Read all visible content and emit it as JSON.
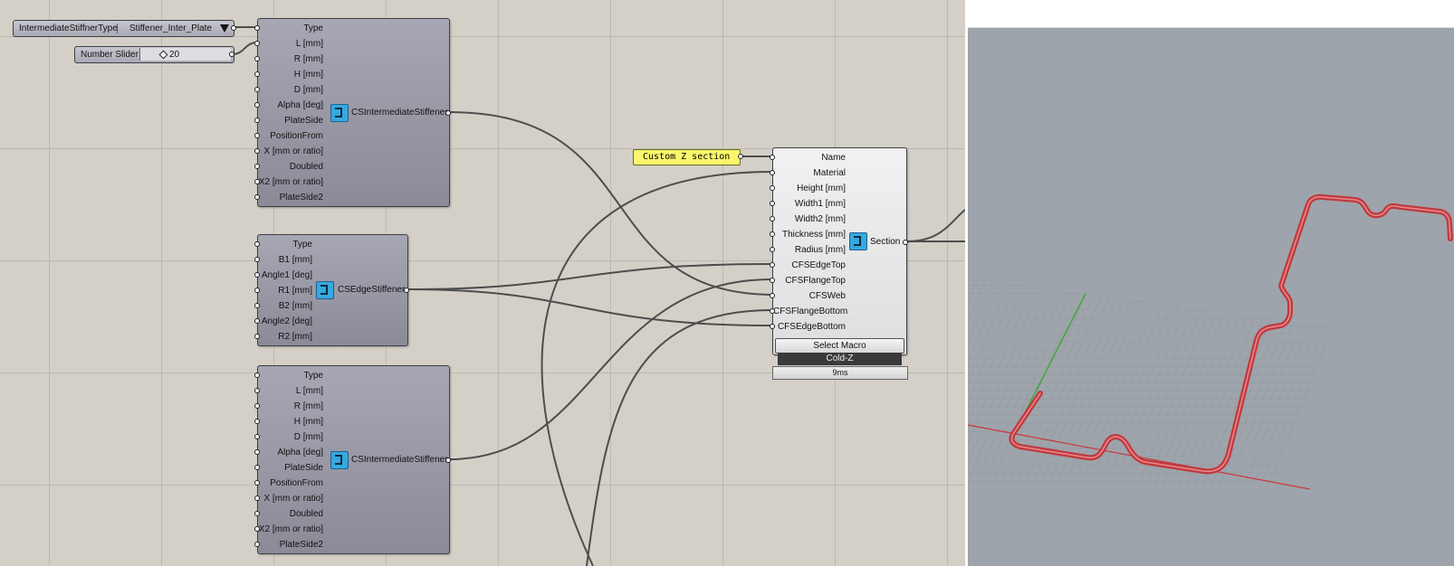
{
  "canvas": {
    "value_list": {
      "label": "IntermediateStiffnerType",
      "value": "Stiffener_Inter_Plate"
    },
    "slider": {
      "label": "Number Slider",
      "value": "20"
    },
    "intermediate_1": {
      "name": "CSIntermediateStiffener",
      "inputs": [
        "Type",
        "L [mm]",
        "R [mm]",
        "H [mm]",
        "D [mm]",
        "Alpha [deg]",
        "PlateSide",
        "PositionFrom",
        "X [mm or ratio]",
        "Doubled",
        "X2 [mm or ratio]",
        "PlateSide2"
      ]
    },
    "edge": {
      "name": "CSEdgeStiffener",
      "inputs": [
        "Type",
        "B1 [mm]",
        "Angle1 [deg]",
        "R1 [mm]",
        "B2 [mm]",
        "Angle2 [deg]",
        "R2 [mm]"
      ]
    },
    "intermediate_2": {
      "name": "CSIntermediateStiffener",
      "inputs": [
        "Type",
        "L [mm]",
        "R [mm]",
        "H [mm]",
        "D [mm]",
        "Alpha [deg]",
        "PlateSide",
        "PositionFrom",
        "X [mm or ratio]",
        "Doubled",
        "X2 [mm or ratio]",
        "PlateSide2"
      ]
    },
    "panel": {
      "text": "Custom Z section"
    },
    "section": {
      "name": "Section",
      "inputs": [
        "Name",
        "Material",
        "Height [mm]",
        "Width1 [mm]",
        "Width2 [mm]",
        "Thickness [mm]",
        "Radius [mm]",
        "CFSEdgeTop",
        "CFSFlangeTop",
        "CFSWeb",
        "CFSFlangeBottom",
        "CFSEdgeBottom"
      ],
      "button": "Select Macro",
      "macro_value": "Cold-Z",
      "timing": "9ms"
    }
  },
  "colors": {
    "canvas_bg": "#d4d0c8",
    "component": "#9a9aa7",
    "panel": "#f9f66b",
    "section_curve": "#c0393f",
    "viewport_bg": "#9ea4ab"
  }
}
